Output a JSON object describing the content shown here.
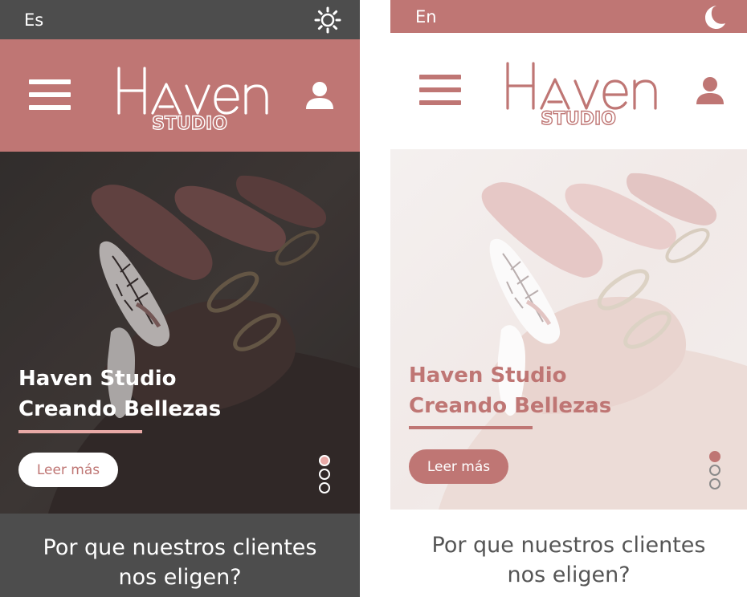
{
  "screens": [
    {
      "theme": "dark",
      "language_label": "Es",
      "theme_toggle_icon": "sun-icon",
      "logo": {
        "main": "Haven",
        "sub": "STUDIO"
      },
      "hero": {
        "title_line1": "Haven Studio",
        "title_line2": "Creando Bellezas",
        "button_label": "Leer más",
        "slides": 3,
        "active_slide": 1
      },
      "section_heading_line1": "Por que nuestros clientes",
      "section_heading_line2": "nos eligen?"
    },
    {
      "theme": "light",
      "language_label": "En",
      "theme_toggle_icon": "moon-icon",
      "logo": {
        "main": "Haven",
        "sub": "STUDIO"
      },
      "hero": {
        "title_line1": "Haven Studio",
        "title_line2": "Creando Bellezas",
        "button_label": "Leer más",
        "slides": 3,
        "active_slide": 1
      },
      "section_heading_line1": "Por que nuestros clientes",
      "section_heading_line2": "nos eligen?"
    }
  ],
  "colors": {
    "brand_rose": "#bf7674",
    "accent_pink": "#e8a9a6",
    "dark_bg": "#4d4d4d",
    "light_bg": "#ffffff"
  }
}
